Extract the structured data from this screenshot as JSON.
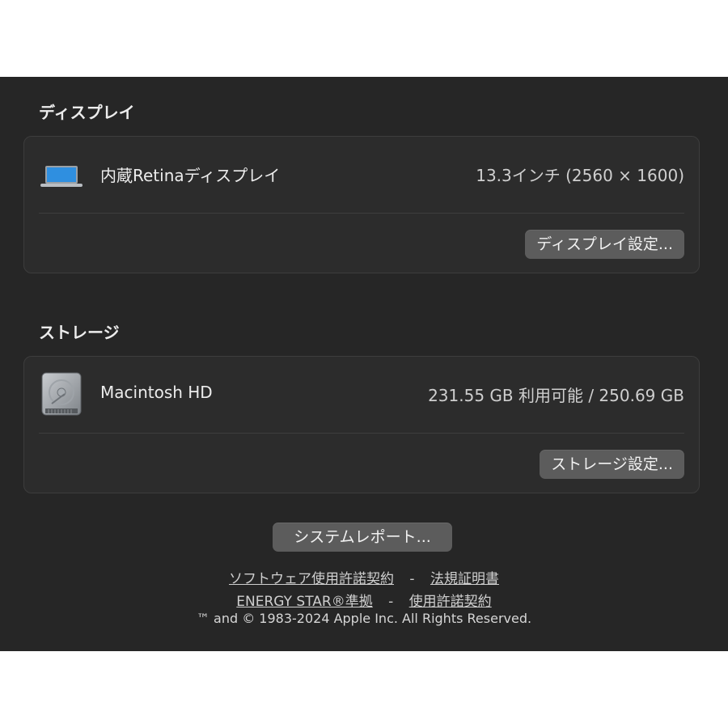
{
  "display_section": {
    "title": "ディスプレイ",
    "item_name": "内蔵Retinaディスプレイ",
    "item_value": "13.3インチ (2560 × 1600)",
    "icon": "laptop-icon",
    "settings_button": "ディスプレイ設定..."
  },
  "storage_section": {
    "title": "ストレージ",
    "item_name": "Macintosh HD",
    "item_value": "231.55 GB 利用可能 / 250.69 GB",
    "icon": "hard-drive-icon",
    "settings_button": "ストレージ設定..."
  },
  "system_report_button": "システムレポート...",
  "links": {
    "software_license": "ソフトウェア使用許諾契約",
    "regulatory": "法規証明書",
    "energy_star": "ENERGY STAR®準拠",
    "license_agreement": "使用許諾契約",
    "separator": "-"
  },
  "copyright": "™ and © 1983-2024 Apple Inc. All Rights Reserved.",
  "colors": {
    "panel_background": "#262626",
    "card_background": "#2c2c2c",
    "button_background": "#5c5c5c",
    "laptop_screen": "#2f8fe0"
  }
}
